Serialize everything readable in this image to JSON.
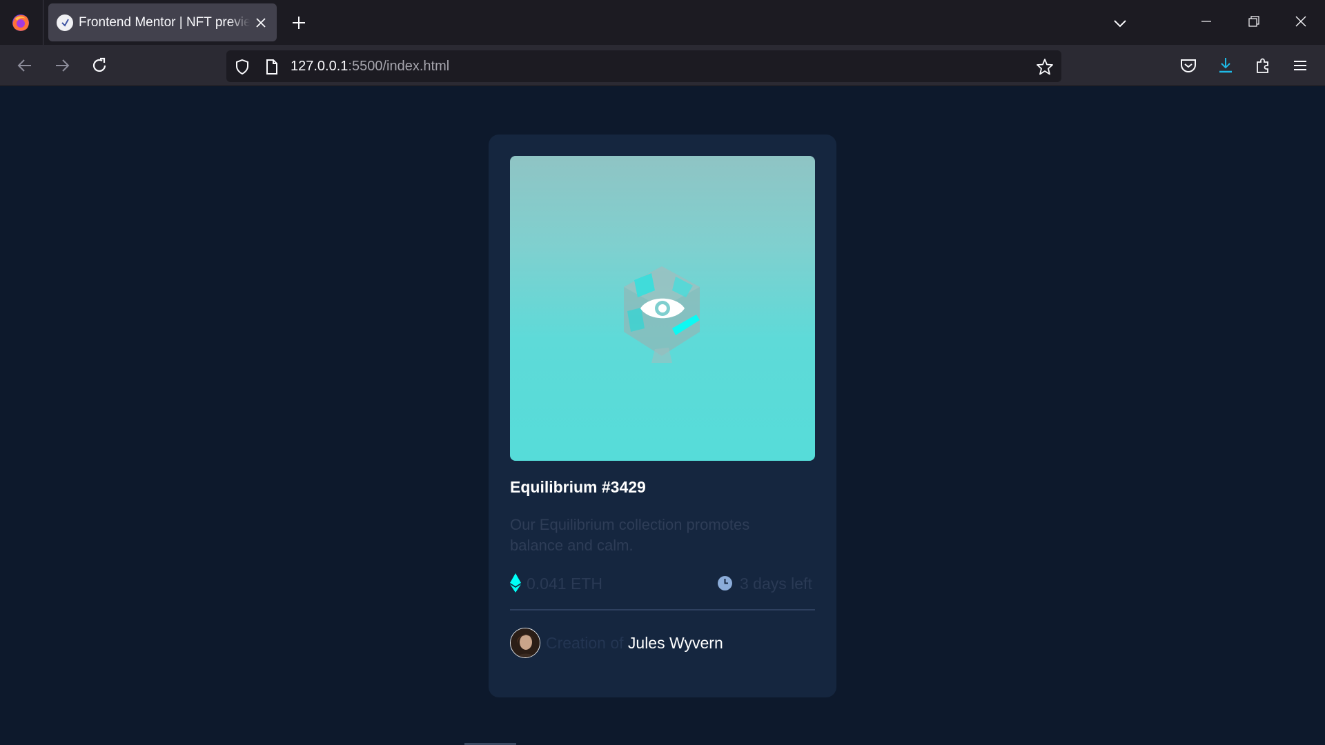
{
  "browser": {
    "tab_title": "Frontend Mentor | NFT preview card component",
    "url_host": "127.0.0.1",
    "url_rest": ":5500/index.html"
  },
  "card": {
    "title": "Equilibrium #3429",
    "description": "Our Equilibrium collection promotes balance and calm.",
    "price": "0.041 ETH",
    "time_left": "3 days left",
    "creator_prefix": "Creation of",
    "creator_name": "Jules Wyvern"
  },
  "colors": {
    "page_background": "#0d192c",
    "card_background": "#15263f",
    "accent_cyan": "#00fff8",
    "soft_blue": "#8bacd9",
    "title_white": "#ffffff"
  },
  "icons": {
    "browser": "firefox-logo",
    "image_overlay": "eye-icon",
    "price": "ethereum-icon",
    "time": "clock-icon"
  }
}
